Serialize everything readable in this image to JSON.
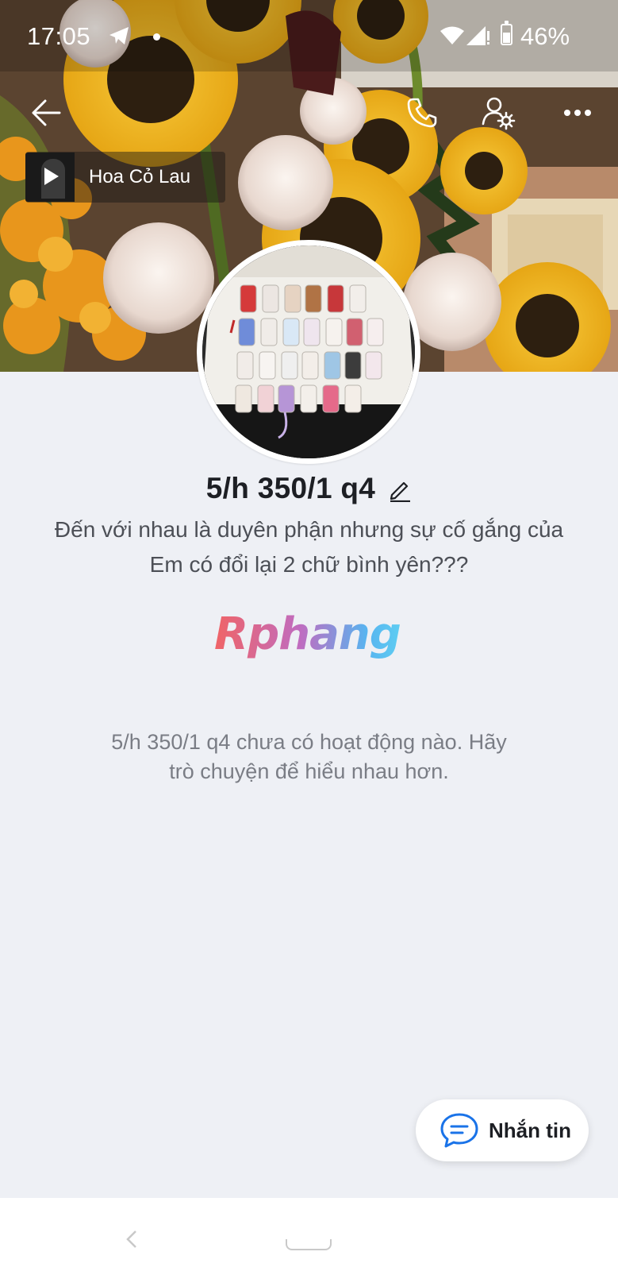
{
  "status_bar": {
    "time": "17:05",
    "battery": "46%"
  },
  "header": {
    "music_title": "Hoa Cỏ Lau"
  },
  "profile": {
    "name": "5/h 350/1 q4",
    "bio_line1": "Đến với nhau là duyên phận nhưng sự cố gắng của",
    "bio_line2": "Em có đổi lại 2 chữ bình yên???",
    "brand_logo_text": "Rphang",
    "empty_line1": "5/h 350/1 q4 chưa có hoạt động nào. Hãy",
    "empty_line2": "trò chuyện để hiểu nhau hơn."
  },
  "actions": {
    "message_label": "Nhắn tin"
  },
  "colors": {
    "accent": "#1a73e8",
    "background": "#eef0f5",
    "name_text": "#1d1f24"
  },
  "icons": {
    "back": "arrow-left-icon",
    "call": "phone-icon",
    "settings": "user-settings-icon",
    "more": "more-horizontal-icon",
    "edit": "pencil-icon",
    "chat": "chat-bubble-icon"
  }
}
